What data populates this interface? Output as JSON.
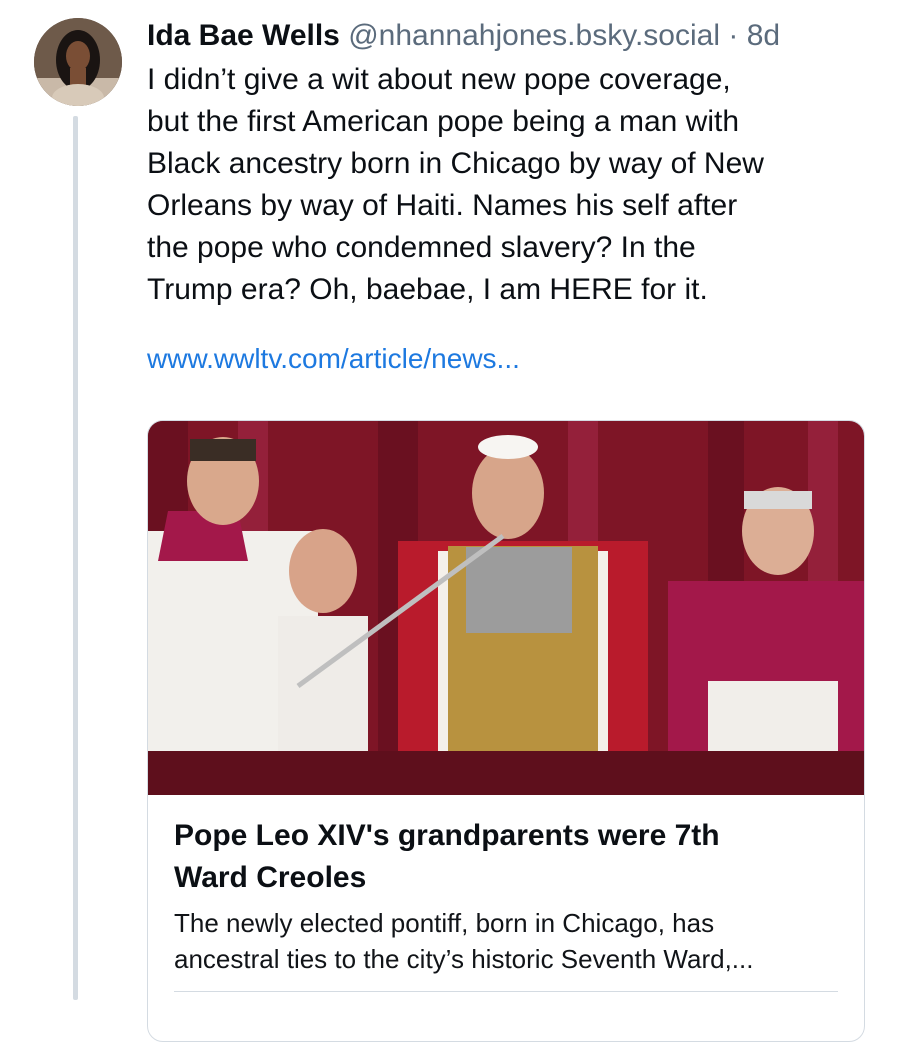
{
  "post": {
    "author_name": "Ida Bae Wells",
    "author_handle": "@nhannahjones.bsky.social",
    "separator": "·",
    "time_ago": "8d",
    "text": "I didn’t give a wit about new pope coverage,\nbut the first American pope being a man with\nBlack ancestry born in Chicago by way of New\nOrleans by way of Haiti. Names his self after\nthe pope who condemned slavery? In the\nTrump era? Oh, baebae, I am HERE for it.",
    "link": "www.wwltv.com/article/news..."
  },
  "link_card": {
    "title": "Pope Leo XIV's grandparents were 7th\nWard Creoles",
    "description": "The newly elected pontiff, born in Chicago, has\nancestral ties to the city’s historic Seventh Ward,..."
  },
  "colors": {
    "link": "#1d79e0",
    "muted": "#5b6b7c",
    "border": "#d4dbe2",
    "curtain": "#8c1a2e"
  }
}
